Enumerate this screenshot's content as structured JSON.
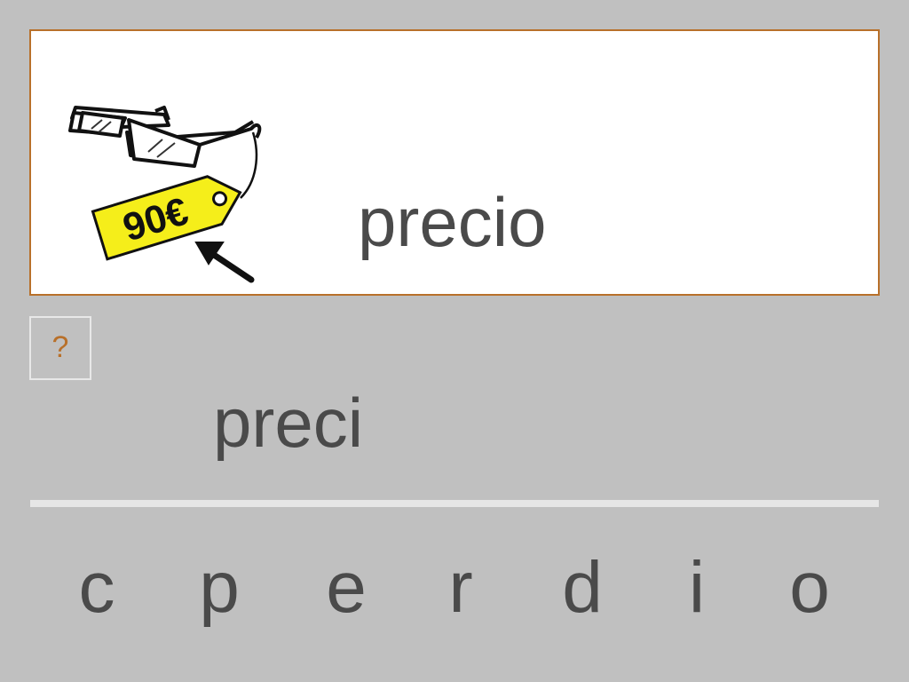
{
  "card": {
    "word": "precio",
    "image": {
      "icon": "glasses-price-tag-icon",
      "price_tag": "90€"
    }
  },
  "hint": {
    "label": "?"
  },
  "answer": {
    "text": "preci"
  },
  "letters": [
    "c",
    "p",
    "e",
    "r",
    "d",
    "i",
    "o"
  ],
  "colors": {
    "background": "#c0c0c0",
    "card_border": "#b8702a",
    "text": "#4a4a4a",
    "tag_yellow": "#f5ee1a",
    "hint_text": "#b8702a"
  }
}
